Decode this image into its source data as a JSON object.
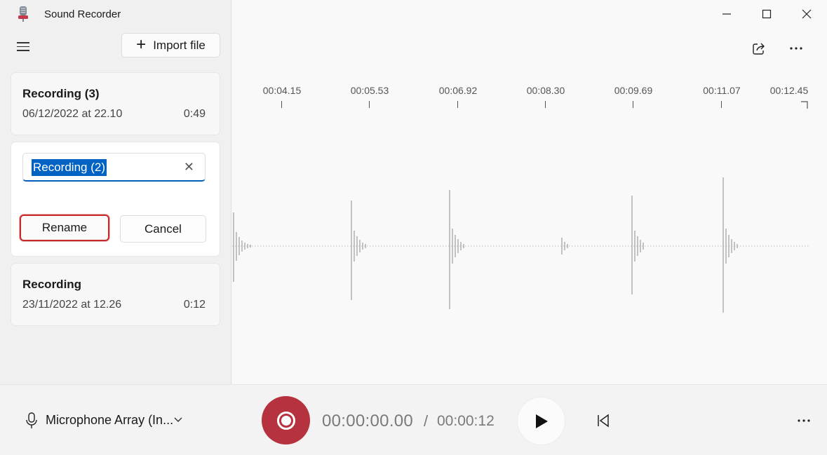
{
  "app": {
    "title": "Sound Recorder"
  },
  "toolbar": {
    "import_label": "Import file",
    "import_plus": "+"
  },
  "recordings": [
    {
      "title": "Recording (3)",
      "date": "06/12/2022 at 22.10",
      "duration": "0:49"
    },
    {
      "rename_value": "Recording (2)",
      "rename_button": "Rename",
      "cancel_button": "Cancel",
      "clear_glyph": "✕"
    },
    {
      "title": "Recording",
      "date": "23/11/2022 at 12.26",
      "duration": "0:12"
    }
  ],
  "timeline": {
    "ticks": [
      "00:04.15",
      "00:05.53",
      "00:06.92",
      "00:08.30",
      "00:09.69",
      "00:11.07",
      "00:12.45"
    ]
  },
  "player": {
    "microphone": "Microphone Array (In...",
    "current_time": "00:00:00.00",
    "separator": "/",
    "total_time": "00:00:12"
  },
  "icons": {
    "app": "microphone-app-icon",
    "menu": "hamburger-icon",
    "share": "share-icon",
    "more": "more-icon",
    "minimize": "minimize-icon",
    "maximize": "maximize-icon",
    "close": "close-icon",
    "record": "record-icon",
    "play": "play-icon",
    "skip_back": "skip-back-icon",
    "chevron": "chevron-down-icon"
  },
  "colors": {
    "record": "#b5323e",
    "accent": "#c23a4b",
    "selection": "#0063c4",
    "focus_outline": "#c62a2a"
  }
}
